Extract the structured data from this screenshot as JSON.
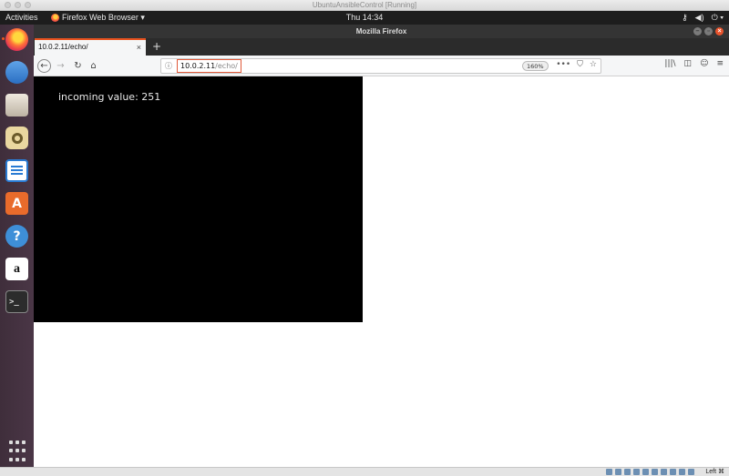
{
  "host": {
    "window_title": "UbuntuAnsibleControl [Running]",
    "host_key": "Left ⌘"
  },
  "top_bar": {
    "activities": "Activities",
    "app_menu": "Firefox Web Browser ▾",
    "clock": "Thu 14:34",
    "tray": [
      "⚷",
      "◀)",
      "⏻ ▾"
    ]
  },
  "dock": {
    "items": [
      {
        "name": "firefox",
        "icon": "firefox-icon",
        "active": true
      },
      {
        "name": "thunderbird",
        "icon": "mail-icon"
      },
      {
        "name": "files",
        "icon": "files-icon"
      },
      {
        "name": "rhythmbox",
        "icon": "music-icon"
      },
      {
        "name": "writer",
        "icon": "document-icon"
      },
      {
        "name": "software",
        "icon": "software-icon",
        "glyph": "A"
      },
      {
        "name": "help",
        "icon": "help-icon",
        "glyph": "?"
      },
      {
        "name": "amazon",
        "icon": "amazon-icon",
        "glyph": "a"
      },
      {
        "name": "terminal",
        "icon": "terminal-icon",
        "glyph": ">_"
      }
    ],
    "show_apps_icon": "grid-icon"
  },
  "browser": {
    "window_title": "Mozilla Firefox",
    "tab": {
      "title": "10.0.2.11/echo/",
      "close": "×"
    },
    "new_tab": "+",
    "url": {
      "host": "10.0.2.11",
      "path": "/echo/"
    },
    "zoom": "160%",
    "nav": {
      "back": "←",
      "forward": "→",
      "reload": "↻",
      "home": "⌂"
    },
    "page_actions": [
      "•••",
      "⛉",
      "☆"
    ],
    "toolbar_right": [
      "|||\\",
      "◫",
      "☺",
      "≡"
    ]
  },
  "page": {
    "incoming_text": "incoming value: 251"
  }
}
